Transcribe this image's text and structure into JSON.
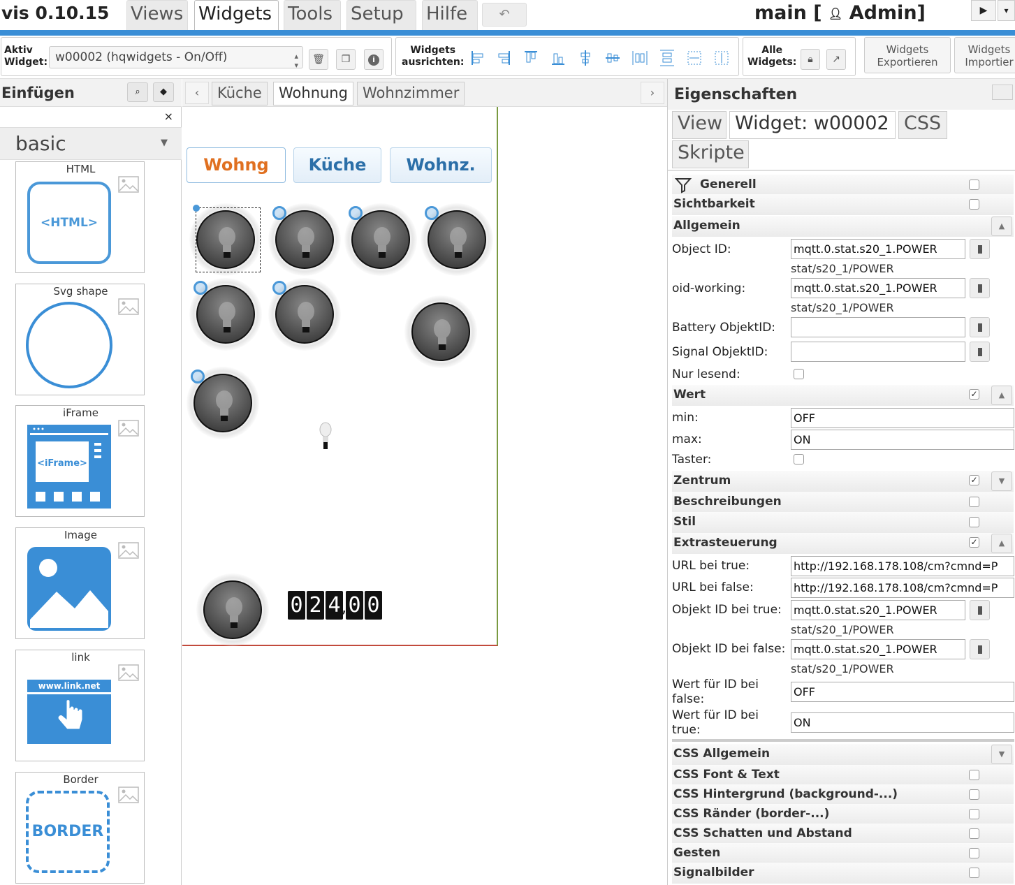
{
  "app": {
    "title": "vis 0.10.15",
    "project": "main [",
    "user": "Admin]"
  },
  "menu": [
    "Views",
    "Widgets",
    "Tools",
    "Setup",
    "Hilfe"
  ],
  "toolbar": {
    "active_label_1": "Aktiv",
    "active_label_2": "Widget:",
    "active_widget": "w00002 (hqwidgets - On/Off)",
    "align_label_1": "Widgets",
    "align_label_2": "ausrichten:",
    "all_label_1": "Alle",
    "all_label_2": "Widgets:",
    "export_1": "Widgets",
    "export_2": "Exportieren",
    "import_1": "Widgets",
    "import_2": "Importier"
  },
  "insert": {
    "title": "Einfügen",
    "close": "×",
    "category": "basic",
    "widgets": [
      {
        "name": "HTML",
        "icon": "html-icon",
        "text": "<HTML>"
      },
      {
        "name": "Svg shape",
        "icon": "circle-shape-icon"
      },
      {
        "name": "iFrame",
        "icon": "iframe-icon",
        "text": "<iFrame>"
      },
      {
        "name": "Image",
        "icon": "image-icon"
      },
      {
        "name": "link",
        "icon": "link-icon",
        "text": "www.link.net"
      },
      {
        "name": "Border",
        "icon": "border-icon",
        "text": "BORDER"
      }
    ]
  },
  "views": {
    "tabs": [
      "Küche",
      "Wohnung",
      "Wohnzimmer"
    ],
    "active": "Wohnung"
  },
  "canvas": {
    "nav_buttons": [
      "Wohng",
      "Küche",
      "Wohnz."
    ],
    "counter": {
      "digits": [
        "0",
        "2",
        "4",
        "0",
        "0"
      ],
      "value": "024,00"
    }
  },
  "props": {
    "title": "Eigenschaften",
    "tabs": [
      "View",
      "Widget: w00002",
      "CSS",
      "Skripte"
    ],
    "generell": "Generell",
    "sichtbarkeit": "Sichtbarkeit",
    "allgemein": "Allgemein",
    "object_id_label": "Object ID:",
    "object_id": "mqtt.0.stat.s20_1.POWER",
    "object_id_sub": "stat/s20_1/POWER",
    "oid_working_label": "oid-working:",
    "oid_working": "mqtt.0.stat.s20_1.POWER",
    "oid_working_sub": "stat/s20_1/POWER",
    "battery_label": "Battery ObjektID:",
    "signal_label": "Signal ObjektID:",
    "readonly_label": "Nur lesend:",
    "wert": "Wert",
    "min_label": "min:",
    "min": "OFF",
    "max_label": "max:",
    "max": "ON",
    "taster_label": "Taster:",
    "zentrum": "Zentrum",
    "beschreibungen": "Beschreibungen",
    "stil": "Stil",
    "extra": "Extrasteuerung",
    "url_true_label": "URL bei true:",
    "url_true": "http://192.168.178.108/cm?cmnd=P",
    "url_false_label": "URL bei false:",
    "url_false": "http://192.168.178.108/cm?cmnd=P",
    "oid_true_label": "Objekt ID bei true:",
    "oid_true": "mqtt.0.stat.s20_1.POWER",
    "oid_true_sub": "stat/s20_1/POWER",
    "oid_false_label": "Objekt ID bei false:",
    "oid_false": "mqtt.0.stat.s20_1.POWER",
    "oid_false_sub": "stat/s20_1/POWER",
    "val_false_label_1": "Wert für ID bei",
    "val_false_label_2": "false:",
    "val_false": "OFF",
    "val_true_label_1": "Wert für ID bei",
    "val_true_label_2": "true:",
    "val_true": "ON",
    "css_sections": [
      "CSS Allgemein",
      "CSS Font & Text",
      "CSS Hintergrund (background-...)",
      "CSS Ränder (border-...)",
      "CSS Schatten und Abstand",
      "Gesten",
      "Signalbilder"
    ]
  },
  "colors": {
    "accent": "#3a8ed6",
    "nav_active": "#e07020",
    "nav_text": "#2b6fa8"
  }
}
